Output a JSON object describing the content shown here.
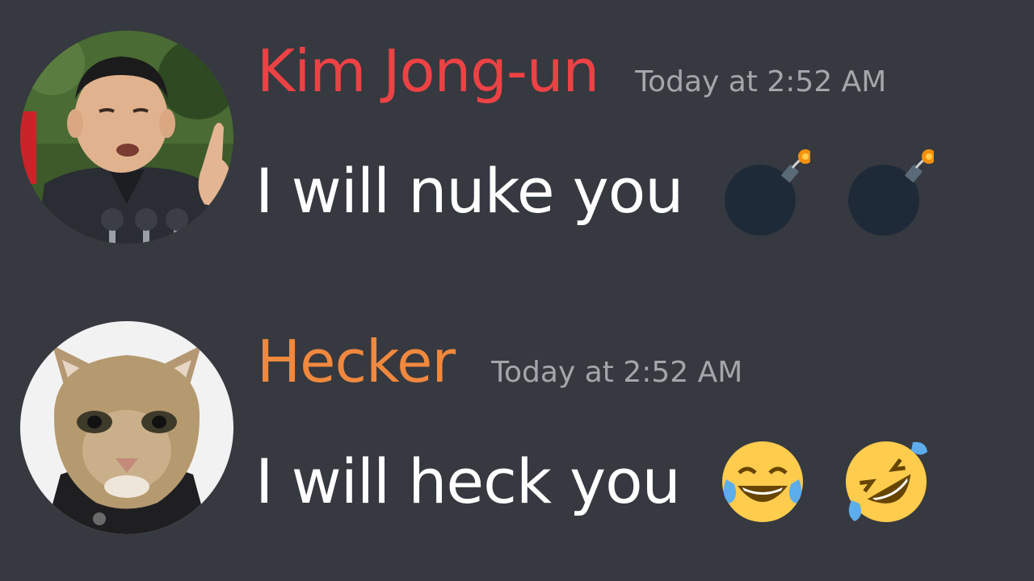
{
  "messages": [
    {
      "username": "Kim Jong-un",
      "username_color": "#ed4245",
      "timestamp": "Today at 2:52 AM",
      "text": "I will nuke you",
      "emojis": [
        "bomb-icon",
        "bomb-icon"
      ],
      "avatar": "person-avatar"
    },
    {
      "username": "Hecker",
      "username_color": "#f0883e",
      "timestamp": "Today at 2:52 AM",
      "text": "I will heck you",
      "emojis": [
        "face-with-tears-of-joy-icon",
        "rolling-on-floor-laughing-icon"
      ],
      "avatar": "cat-avatar"
    }
  ],
  "colors": {
    "background": "#36393f",
    "message_text": "#ffffff",
    "timestamp": "#a3a6aa"
  }
}
